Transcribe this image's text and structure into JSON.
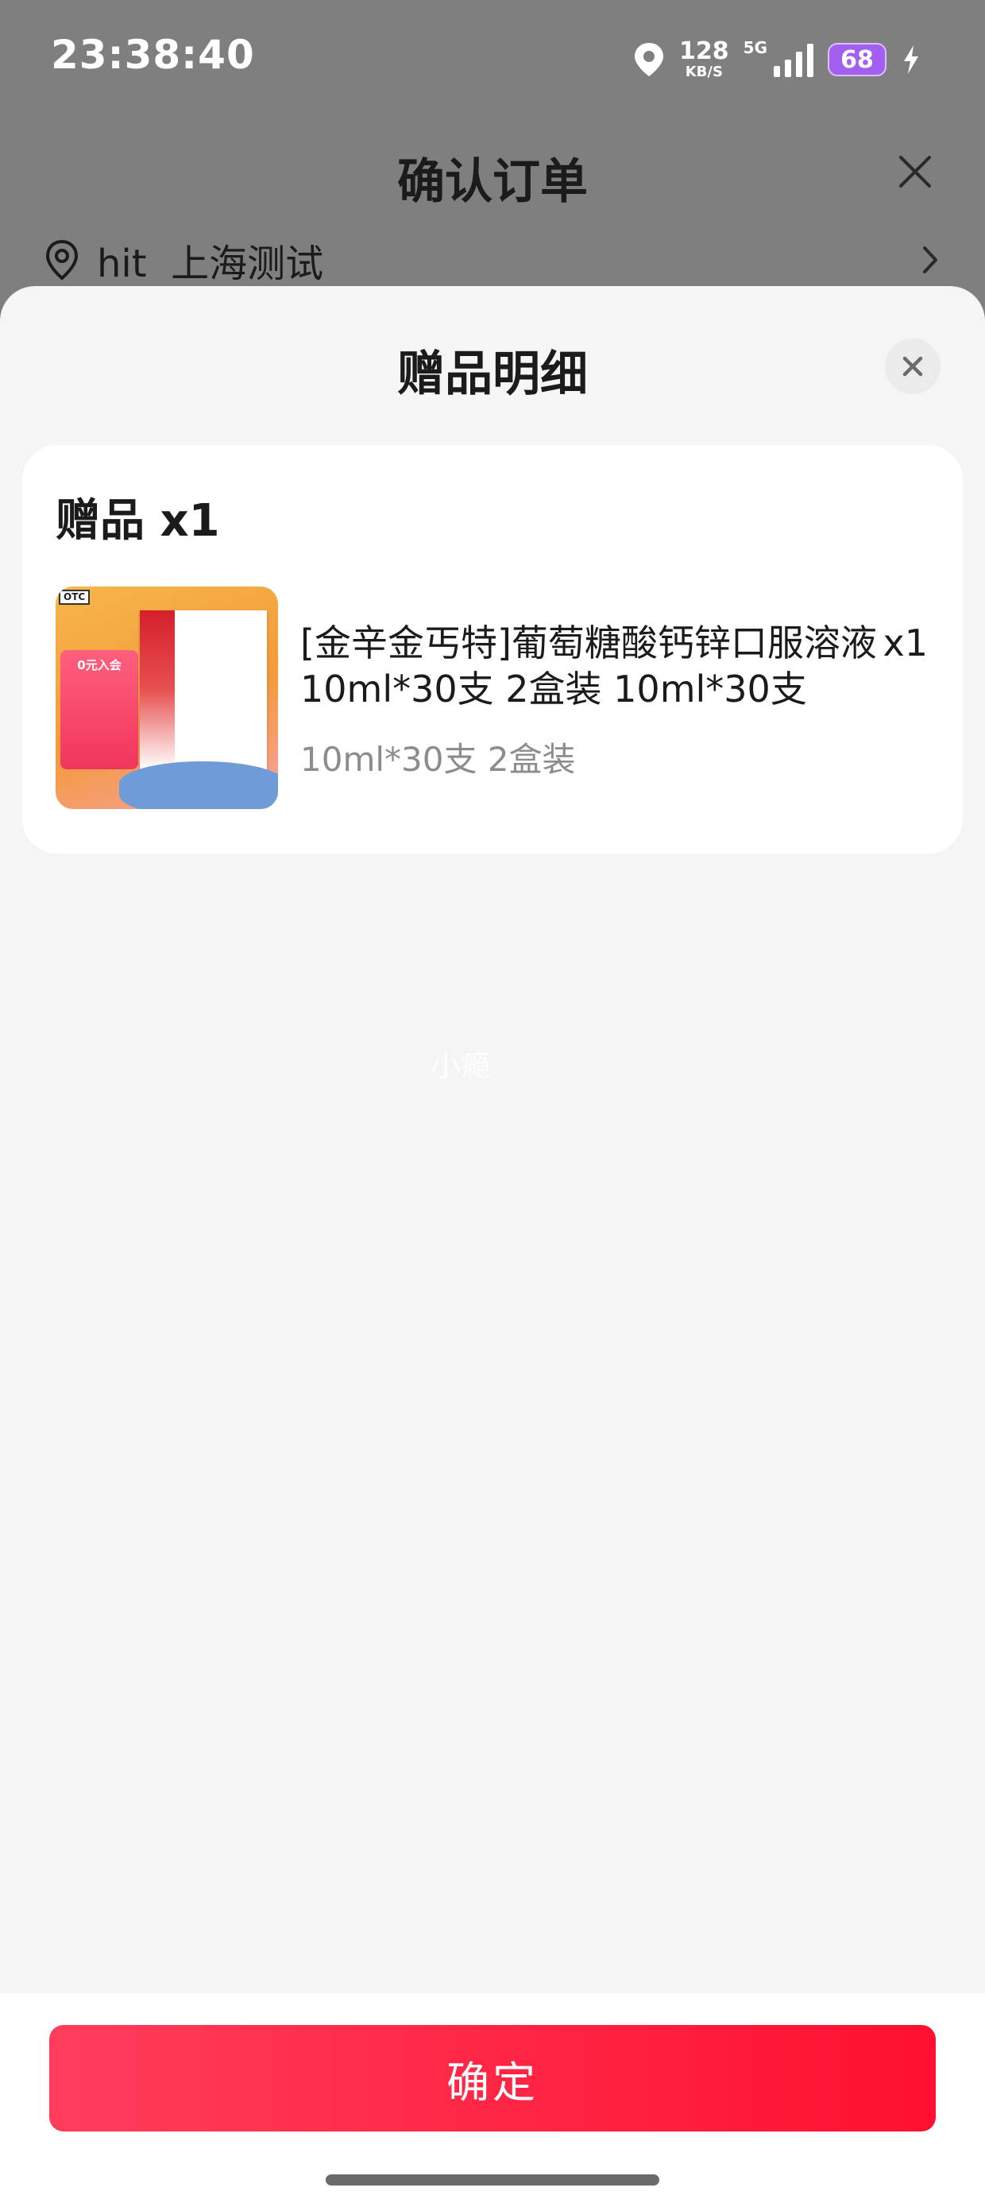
{
  "status_bar": {
    "time": "23:38:40",
    "net_speed": "128",
    "net_unit": "KB/S",
    "network": "5G",
    "battery": "68"
  },
  "order_page": {
    "title": "确认订单",
    "address": "hit  上海测试"
  },
  "gift_sheet": {
    "title": "赠品明细",
    "gift_count": "赠品 x1",
    "product": {
      "name": "[金辛金丐特]葡萄糖酸钙锌口服溶液 10ml*30支 2盒装 10ml*30支",
      "quantity": "x1",
      "spec": "10ml*30支 2盒装",
      "thumb_otc": "OTC",
      "thumb_promo": "0元入会"
    },
    "watermark": "小瘾"
  },
  "footer": {
    "confirm_label": "确定"
  },
  "colors": {
    "accent": "#ff1f3d",
    "overlay": "#7f7f7f",
    "sheet_bg": "#f5f5f5"
  }
}
